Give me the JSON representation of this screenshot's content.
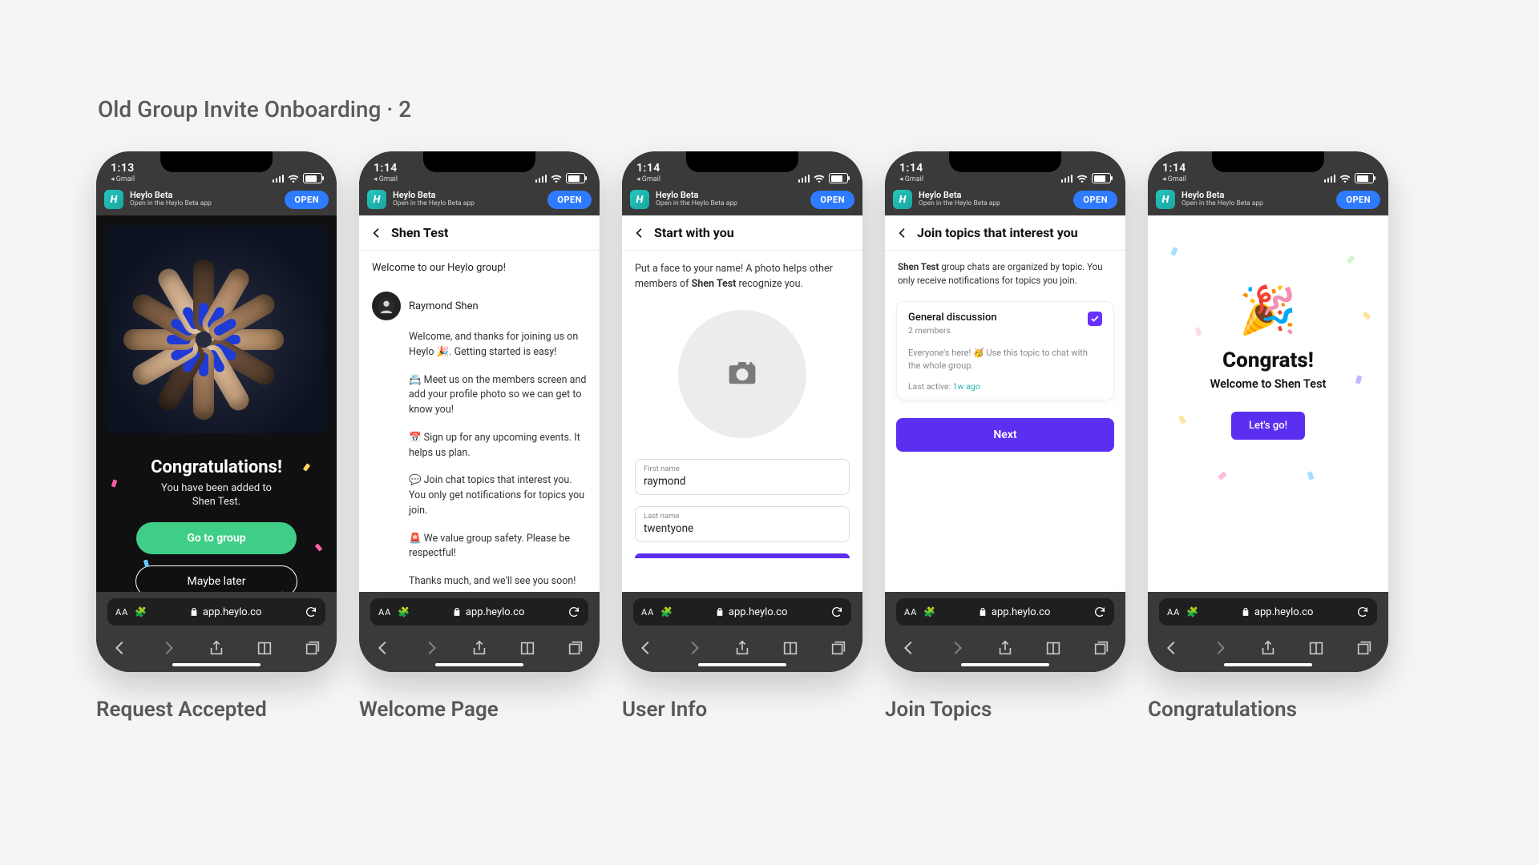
{
  "page_title": "Old Group Invite Onboarding · 2",
  "captions": [
    "Request Accepted",
    "Welcome Page",
    "User Info",
    "Join Topics",
    "Congratulations"
  ],
  "common": {
    "gmail_back": "◂ Gmail",
    "banner_title": "Heylo Beta",
    "banner_sub": "Open in the Heylo Beta app",
    "banner_open": "OPEN",
    "url": "app.heylo.co",
    "aa": "AA"
  },
  "times": [
    "1:13",
    "1:14",
    "1:14",
    "1:14",
    "1:14"
  ],
  "s1": {
    "title": "Congratulations!",
    "line1": "You have been added to",
    "group": "Shen Test.",
    "primary": "Go to group",
    "secondary": "Maybe later"
  },
  "s2": {
    "nav": "Shen Test",
    "welcome": "Welcome to our Heylo group!",
    "author": "Raymond Shen",
    "p1": "Welcome, and thanks for joining us on Heylo 🎉. Getting started is easy!",
    "p2": "📇 Meet us on the members screen and add your profile photo so we can get to know you!",
    "p3": "📅 Sign up for any upcoming events. It helps us plan.",
    "p4": "💬 Join chat topics that interest you. You only get notifications for topics you join.",
    "p5": "🚨 We value group safety. Please be respectful!",
    "p6": "Thanks much, and we'll see you soon!"
  },
  "s3": {
    "nav": "Start with you",
    "intro_a": "Put a face to your name! A photo helps other members of ",
    "intro_b": "Shen Test",
    "intro_c": " recognize you.",
    "first_label": "First name",
    "first_val": "raymond",
    "last_label": "Last name",
    "last_val": "twentyone"
  },
  "s4": {
    "nav": "Join topics that interest you",
    "desc_a": "Shen Test",
    "desc_b": " group chats are organized by topic. You only receive notifications for topics you join.",
    "topic_name": "General discussion",
    "topic_members": "2 members",
    "topic_desc": "Everyone's here! 🥳 Use this topic to chat with the whole group.",
    "last_active_label": "Last active: ",
    "last_active_val": "1w ago",
    "next": "Next"
  },
  "s5": {
    "title": "Congrats!",
    "sub": "Welcome to Shen Test",
    "cta": "Let's go!"
  }
}
